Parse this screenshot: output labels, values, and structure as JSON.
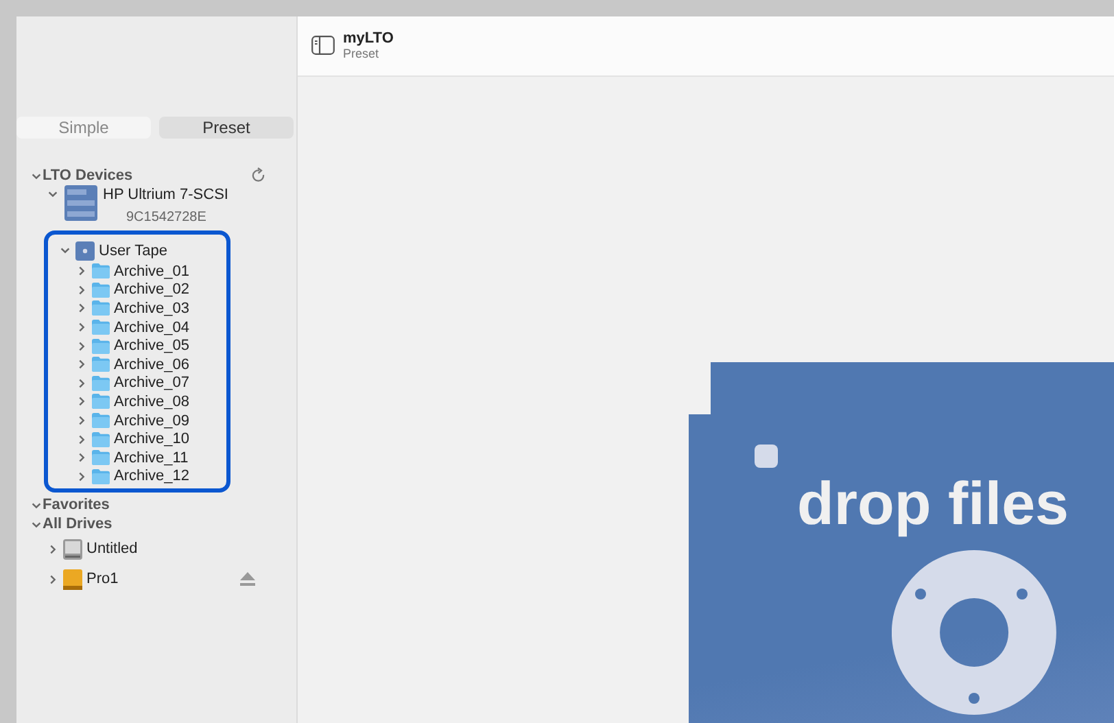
{
  "header": {
    "title": "myLTO",
    "subtitle": "Preset"
  },
  "mode_tabs": [
    {
      "label": "Simple",
      "selected": false
    },
    {
      "label": "Preset",
      "selected": true
    }
  ],
  "sidebar": {
    "sections": [
      {
        "title": "LTO Devices",
        "expanded": true,
        "refresh": true,
        "items": [
          {
            "kind": "drive",
            "name": "HP Ultrium 7-SCSI",
            "detail": "9C1542728E",
            "expanded": true,
            "children": [
              {
                "kind": "tape",
                "name": "User Tape",
                "expanded": true,
                "highlighted": true,
                "children": [
                  {
                    "kind": "folder",
                    "name": "Archive_01",
                    "expanded": false
                  },
                  {
                    "kind": "folder",
                    "name": "Archive_02",
                    "expanded": false
                  },
                  {
                    "kind": "folder",
                    "name": "Archive_03",
                    "expanded": false
                  },
                  {
                    "kind": "folder",
                    "name": "Archive_04",
                    "expanded": false
                  },
                  {
                    "kind": "folder",
                    "name": "Archive_05",
                    "expanded": false
                  },
                  {
                    "kind": "folder",
                    "name": "Archive_06",
                    "expanded": false
                  },
                  {
                    "kind": "folder",
                    "name": "Archive_07",
                    "expanded": false
                  },
                  {
                    "kind": "folder",
                    "name": "Archive_08",
                    "expanded": false
                  },
                  {
                    "kind": "folder",
                    "name": "Archive_09",
                    "expanded": false
                  },
                  {
                    "kind": "folder",
                    "name": "Archive_10",
                    "expanded": false
                  },
                  {
                    "kind": "folder",
                    "name": "Archive_11",
                    "expanded": false
                  },
                  {
                    "kind": "folder",
                    "name": "Archive_12",
                    "expanded": false
                  }
                ]
              }
            ]
          }
        ]
      },
      {
        "title": "Favorites",
        "expanded": true,
        "refresh": false
      },
      {
        "title": "All Drives",
        "expanded": true,
        "refresh": false,
        "items": [
          {
            "kind": "disk",
            "name": "Untitled",
            "expanded": false,
            "ejectable": false
          },
          {
            "kind": "volume",
            "name": "Pro1",
            "expanded": false,
            "ejectable": true
          }
        ]
      }
    ]
  },
  "drop_zone": {
    "label": "drop files"
  }
}
